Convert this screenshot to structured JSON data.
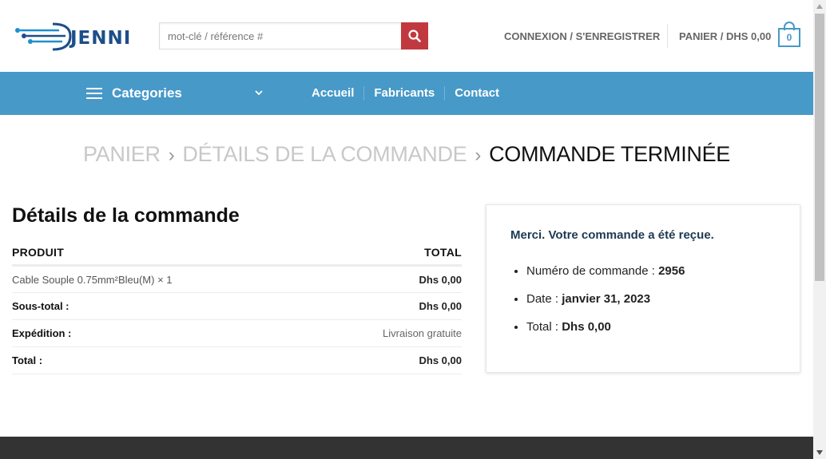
{
  "header": {
    "logo_text": "JENNI",
    "search": {
      "placeholder": "mot-clé / référence #"
    },
    "login_label": "CONNEXION / S'ENREGISTRER",
    "cart_label": "PANIER / DHS 0,00",
    "cart_count": "0"
  },
  "nav": {
    "categories_label": "Categories",
    "links": [
      "Accueil",
      "Fabricants",
      "Contact"
    ]
  },
  "breadcrumb": {
    "step1": "PANIER",
    "step2": "DÉTAILS DE LA COMMANDE",
    "step3": "COMMANDE TERMINÉE",
    "separator": "›"
  },
  "order": {
    "title": "Détails de la commande",
    "col_product": "PRODUIT",
    "col_total": "TOTAL",
    "rows": [
      {
        "label": "Cable Souple 0.75mm²Bleu(M) × 1",
        "value": "Dhs 0,00"
      },
      {
        "label": "Sous-total :",
        "value": "Dhs 0,00"
      },
      {
        "label": "Expédition :",
        "value": "Livraison gratuite"
      },
      {
        "label": "Total :",
        "value": "Dhs 0,00"
      }
    ]
  },
  "thanks": {
    "message": "Merci. Votre commande a été reçue.",
    "items": [
      {
        "label": "Numéro de commande :",
        "value": "2956"
      },
      {
        "label": "Date :",
        "value": "janvier 31, 2023"
      },
      {
        "label": "Total :",
        "value": "Dhs 0,00"
      }
    ]
  },
  "colors": {
    "nav_blue": "#4799c8",
    "search_red": "#c1393e",
    "footer_dark": "#333333"
  }
}
